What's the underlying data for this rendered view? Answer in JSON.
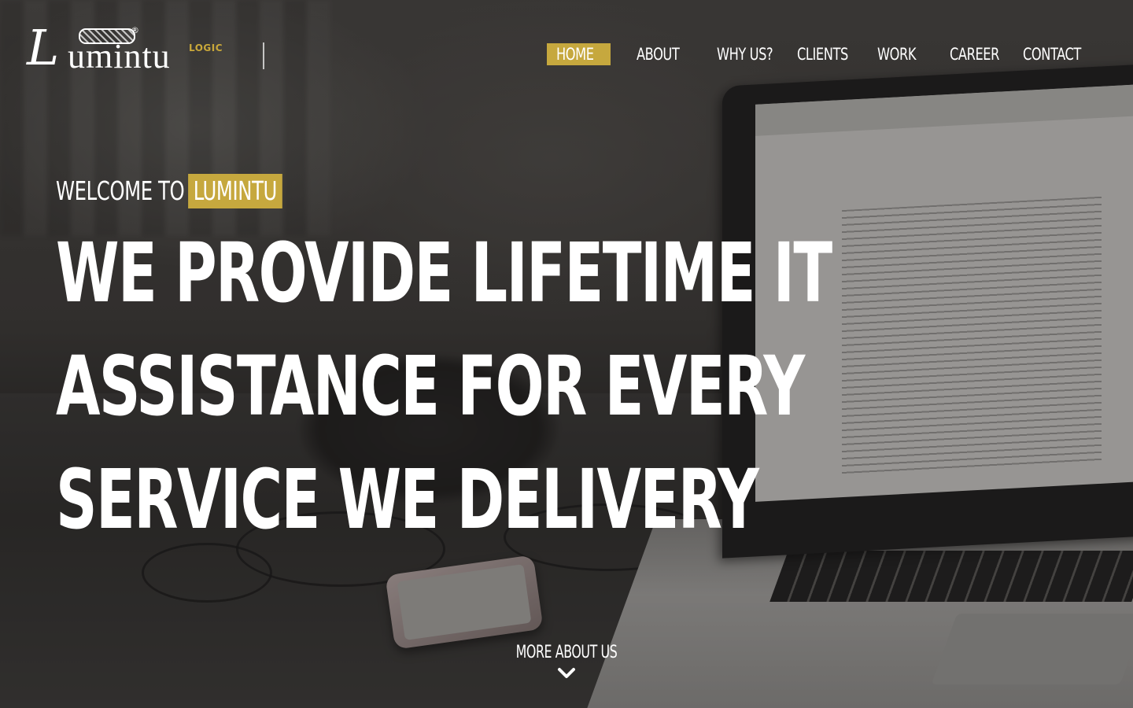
{
  "logo": {
    "letter": "L",
    "word": "umintu",
    "sub": "LOGIC",
    "reg": "®"
  },
  "nav": {
    "items": [
      {
        "label": "HOME",
        "active": true
      },
      {
        "label": "ABOUT",
        "active": false
      },
      {
        "label": "WHY US?",
        "active": false
      },
      {
        "label": "CLIENTS",
        "active": false
      },
      {
        "label": "WORK",
        "active": false
      },
      {
        "label": "CAREER",
        "active": false
      },
      {
        "label": "CONTACT",
        "active": false
      }
    ]
  },
  "hero": {
    "welcome_prefix": "WELCOME TO",
    "welcome_brand": "LUMINTU",
    "headline_lines": [
      "WE PROVIDE LIFETIME IT",
      "ASSISTANCE FOR EVERY",
      "SERVICE WE DELIVERY"
    ]
  },
  "more": {
    "label": "MORE ABOUT US",
    "icon": "chevron-down-icon"
  },
  "colors": {
    "accent": "#c6a83e",
    "text": "#ffffff"
  }
}
